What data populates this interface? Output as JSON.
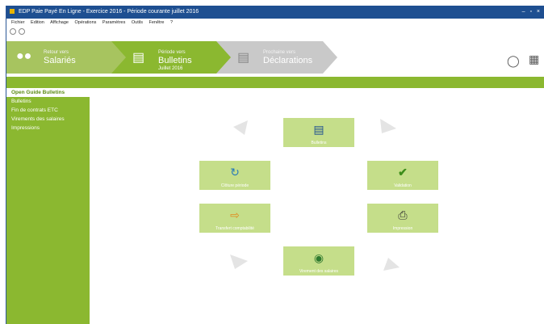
{
  "window": {
    "title": "EDP Paie Payé En Ligne - Exercice 2016 - Période courante juillet 2016",
    "controls": "– ▫ ×"
  },
  "menu": {
    "items": [
      "Fichier",
      "Edition",
      "Affichage",
      "Opérations",
      "Paramètres",
      "Outils",
      "Fenêtre",
      "?"
    ]
  },
  "steps": [
    {
      "small": "Retour vers",
      "big": "Salariés",
      "sub": ""
    },
    {
      "small": "Période vers",
      "big": "Bulletins",
      "sub": "Juillet 2016"
    },
    {
      "small": "Prochaine vers",
      "big": "Déclarations",
      "sub": ""
    }
  ],
  "header_icons": [
    "chat-icon",
    "building-icon"
  ],
  "sidebar": {
    "items": [
      {
        "label": "Open Guide Bulletins"
      },
      {
        "label": "Bulletins"
      },
      {
        "label": "Fin de contrats ETC"
      },
      {
        "label": "Virements des salaires"
      },
      {
        "label": "Impressions"
      }
    ]
  },
  "tiles": {
    "bulletins": "Bulletins",
    "cloture": "Clôture période",
    "validation": "Validation",
    "transfert": "Transfert comptabilité",
    "impression": "Impression",
    "virements": "Virement des salaires"
  },
  "colors": {
    "accent": "#8bb830",
    "tile": "#c5de8a",
    "titlebar": "#1e4f91"
  }
}
